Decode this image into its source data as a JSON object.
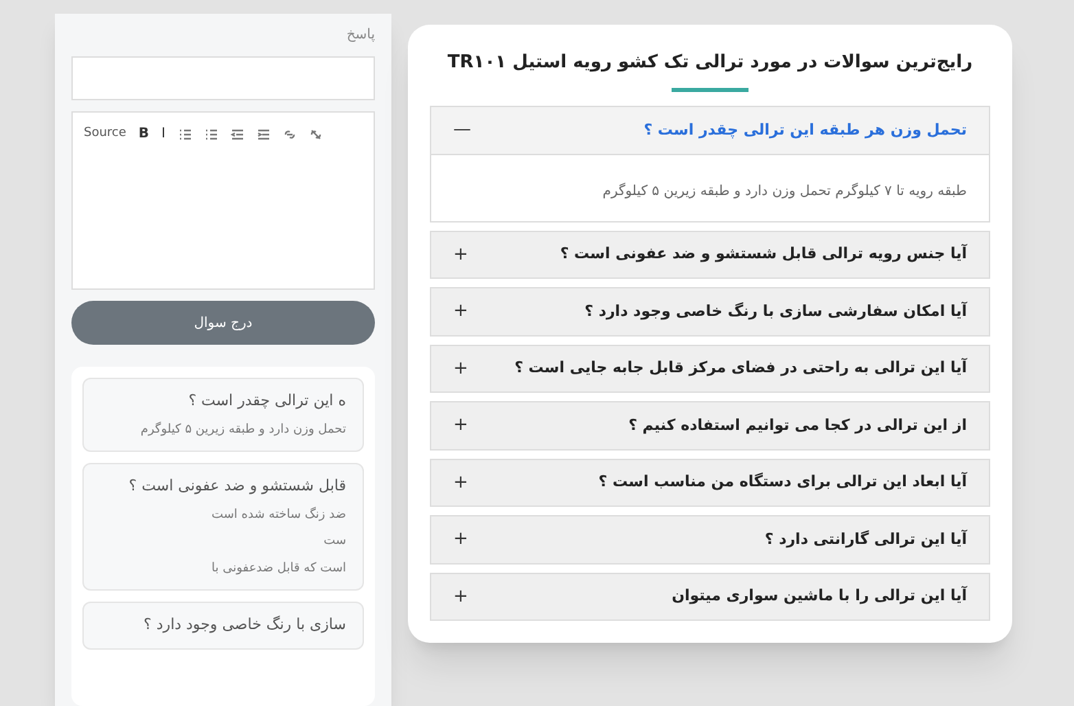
{
  "answer_form": {
    "label": "پاسخ",
    "toolbar": {
      "source": "Source",
      "bold": "B",
      "italic": "I"
    },
    "submit": "درج سوال"
  },
  "submitted_faqs": [
    {
      "question": "ه این ترالی چقدر است ؟",
      "answer_lines": [
        "تحمل وزن دارد و طبقه زیرین ۵ کیلوگرم"
      ]
    },
    {
      "question": "قابل شستشو و ضد عفونی است ؟",
      "answer_lines": [
        "ضد زنگ ساخته شده است",
        "ست",
        "است که قابل ضدعفونی با"
      ]
    },
    {
      "question": "سازی با رنگ خاصی وجود دارد ؟"
    }
  ],
  "faq": {
    "title": "رایج‌ترین سوالات در مورد ترالی تک کشو رویه استیل TR۱۰۱",
    "items": [
      {
        "question": "تحمل وزن هر طبقه این ترالی چقدر است ؟",
        "expanded": true,
        "toggle": "—",
        "answer": "طبقه رویه تا ۷ کیلوگرم تحمل وزن دارد و طبقه زیرین ۵ کیلوگرم"
      },
      {
        "question": "آیا جنس رویه ترالی قابل شستشو و ضد عفونی است ؟",
        "expanded": false,
        "toggle": "+"
      },
      {
        "question": "آیا امکان سفارشی سازی با رنگ خاصی وجود دارد ؟",
        "expanded": false,
        "toggle": "+"
      },
      {
        "question": "آیا این ترالی به راحتی در فضای مرکز قابل جابه جایی است ؟",
        "expanded": false,
        "toggle": "+"
      },
      {
        "question": "از این ترالی در کجا می توانیم استفاده کنیم ؟",
        "expanded": false,
        "toggle": "+"
      },
      {
        "question": "آیا ابعاد این ترالی برای دستگاه من مناسب است ؟",
        "expanded": false,
        "toggle": "+"
      },
      {
        "question": "آیا این ترالی گارانتی دارد ؟",
        "expanded": false,
        "toggle": "+"
      },
      {
        "question": "آیا این ترالی را با ماشین سواری میتوان",
        "expanded": false,
        "toggle": "+"
      }
    ]
  }
}
